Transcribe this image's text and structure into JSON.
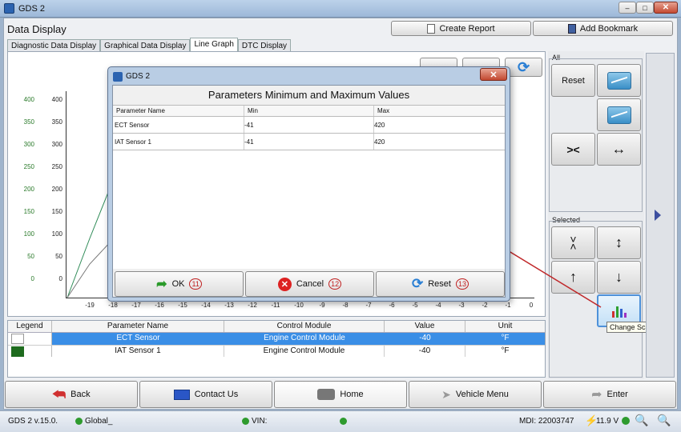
{
  "window": {
    "title": "GDS 2"
  },
  "header": {
    "title": "Data Display",
    "create_report": "Create Report",
    "add_bookmark": "Add Bookmark"
  },
  "tabs": [
    "Diagnostic Data Display",
    "Graphical Data Display",
    "Line Graph",
    "DTC Display"
  ],
  "active_tab": "Line Graph",
  "graph": {
    "y_left": [
      "400",
      "350",
      "300",
      "250",
      "200",
      "150",
      "100",
      "50",
      "0"
    ],
    "y_right": [
      "400",
      "350",
      "300",
      "250",
      "200",
      "150",
      "100",
      "50",
      "0"
    ],
    "x_ticks": [
      "-19",
      "-18",
      "-17",
      "-16",
      "-15",
      "-14",
      "-13",
      "-12",
      "-11",
      "-10",
      "-9",
      "-8",
      "-7",
      "-6",
      "-5",
      "-4",
      "-3",
      "-2",
      "-1",
      "0"
    ],
    "colors": {
      "ect": "#2e8b57",
      "iat": "#777777"
    }
  },
  "right_panel": {
    "all_label": "All",
    "reset_label": "Reset",
    "selected_label": "Selected",
    "tooltip": "Change Scale"
  },
  "legend_table": {
    "headers": [
      "Legend",
      "Parameter Name",
      "Control Module",
      "Value",
      "Unit"
    ],
    "rows": [
      {
        "name": "ECT Sensor",
        "module": "Engine Control Module",
        "value": "-40",
        "unit": "°F",
        "color": "#ffffff",
        "selected": true
      },
      {
        "name": "IAT Sensor 1",
        "module": "Engine Control Module",
        "value": "-40",
        "unit": "°F",
        "color": "#1e6b1e",
        "selected": false
      }
    ]
  },
  "dialog": {
    "title": "GDS 2",
    "heading": "Parameters Minimum and Maximum Values",
    "columns": [
      "Parameter Name",
      "Min",
      "Max"
    ],
    "rows": [
      {
        "name": "ECT Sensor",
        "min": "-41",
        "max": "420"
      },
      {
        "name": "IAT Sensor 1",
        "min": "-41",
        "max": "420"
      }
    ],
    "ok_label": "OK",
    "ok_num": "11",
    "cancel_label": "Cancel",
    "cancel_num": "12",
    "reset_label": "Reset",
    "reset_num": "13"
  },
  "bottom_nav": {
    "back": "Back",
    "contact": "Contact Us",
    "home": "Home",
    "vehicle_menu": "Vehicle Menu",
    "enter": "Enter"
  },
  "status_bar": {
    "version": "GDS 2 v.15.0.",
    "global": "Global_",
    "vin": "VIN:",
    "mdi": "MDI: 22003747",
    "voltage": "11.9 V"
  }
}
